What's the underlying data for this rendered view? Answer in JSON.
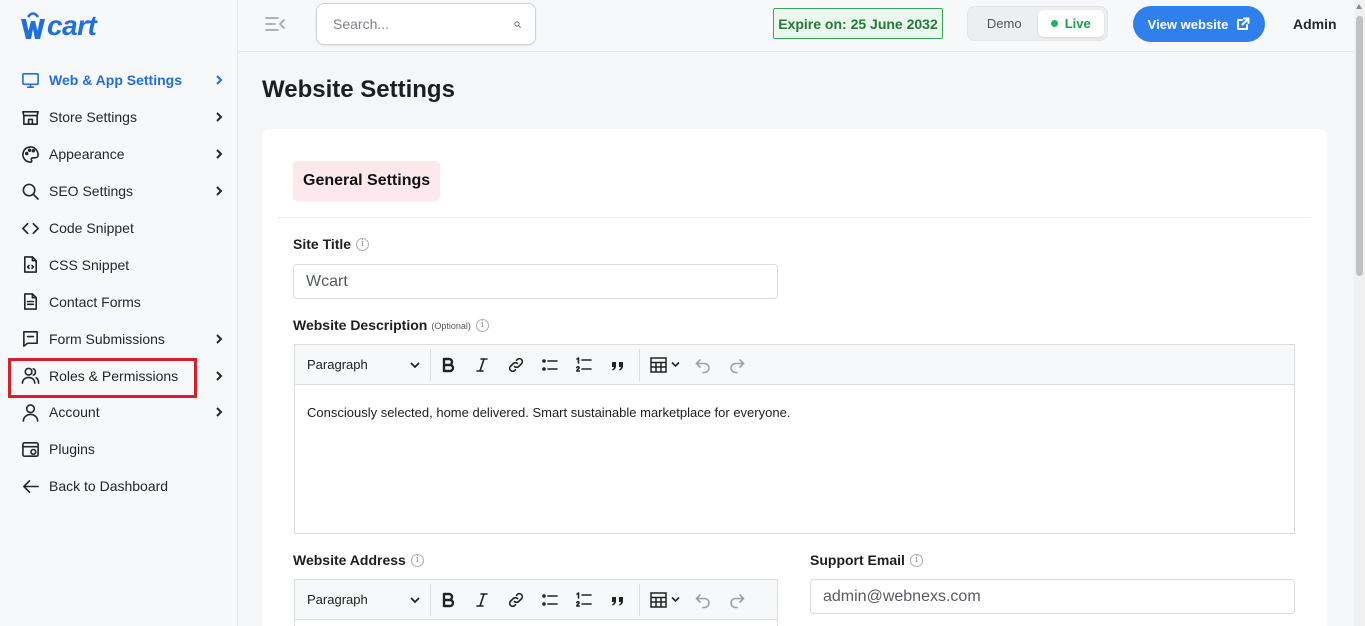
{
  "brand": {
    "logo_text": "cart",
    "logo_letter": "W",
    "accent": "#1f6fe0"
  },
  "sidebar": {
    "items": [
      {
        "label": "Web & App Settings",
        "icon": "monitor-icon",
        "has_chevron": true,
        "active": true
      },
      {
        "label": "Store Settings",
        "icon": "store-icon",
        "has_chevron": true
      },
      {
        "label": "Appearance",
        "icon": "palette-icon",
        "has_chevron": true
      },
      {
        "label": "SEO Settings",
        "icon": "search-icon",
        "has_chevron": true
      },
      {
        "label": "Code Snippet",
        "icon": "code-icon",
        "has_chevron": false
      },
      {
        "label": "CSS Snippet",
        "icon": "css-file-icon",
        "has_chevron": false
      },
      {
        "label": "Contact Forms",
        "icon": "document-icon",
        "has_chevron": false
      },
      {
        "label": "Form Submissions",
        "icon": "form-icon",
        "has_chevron": true
      },
      {
        "label": "Roles & Permissions",
        "icon": "users-icon",
        "has_chevron": true,
        "highlighted": true
      },
      {
        "label": "Account",
        "icon": "user-icon",
        "has_chevron": true
      },
      {
        "label": "Plugins",
        "icon": "plugin-icon",
        "has_chevron": false
      },
      {
        "label": "Back to Dashboard",
        "icon": "arrow-left-icon",
        "has_chevron": false
      }
    ]
  },
  "topbar": {
    "search_placeholder": "Search...",
    "expire_text": "Expire on: 25 June 2032",
    "mode_options": [
      "Demo",
      "Live"
    ],
    "mode_selected": "Live",
    "view_website_label": "View website",
    "user_label": "Admin"
  },
  "main": {
    "title": "Website Settings",
    "section_tab": "General Settings",
    "site_title": {
      "label": "Site Title",
      "value": "Wcart"
    },
    "website_description": {
      "label": "Website Description",
      "optional_note": "(Optional)",
      "format": "Paragraph",
      "content": "Consciously selected, home delivered. Smart sustainable marketplace for everyone."
    },
    "website_address": {
      "label": "Website Address",
      "format": "Paragraph"
    },
    "support_email": {
      "label": "Support Email",
      "value": "admin@webnexs.com"
    }
  }
}
